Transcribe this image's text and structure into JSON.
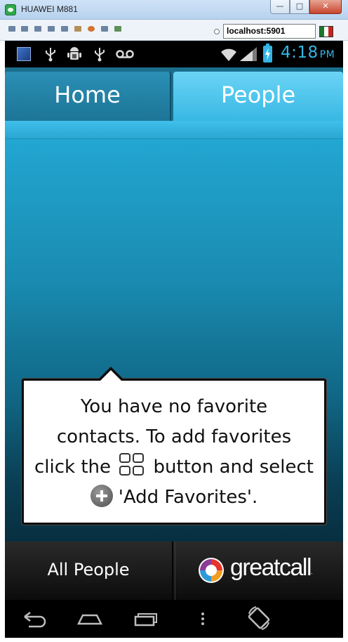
{
  "window": {
    "title": "HUAWEI M881",
    "address": "localhost:5901",
    "minimize_glyph": "—",
    "maximize_glyph": "□",
    "close_glyph": "✕"
  },
  "status_bar": {
    "time": "4:18",
    "ampm": "PM",
    "icons": [
      "notification-square-icon",
      "usb-icon",
      "android-debug-icon",
      "usb-icon",
      "voicemail-icon",
      "wifi-icon",
      "signal-icon",
      "battery-charging-icon"
    ],
    "accent_color": "#33b5e5"
  },
  "tabs": [
    {
      "label": "Home",
      "selected": false
    },
    {
      "label": "People",
      "selected": true
    }
  ],
  "callout": {
    "line1": "You have no favorite",
    "line2": "contacts. To add favorites",
    "line3_before": "click the",
    "line3_after": "button and select",
    "line4": "'Add Favorites'."
  },
  "bottom_bar": {
    "all_people_label": "All People",
    "brand_name": "greatcall",
    "brand_mark": "."
  },
  "nav_bar": {
    "buttons": [
      "back-icon",
      "home-icon",
      "recent-apps-icon",
      "menu-icon",
      "rotate-icon"
    ]
  }
}
